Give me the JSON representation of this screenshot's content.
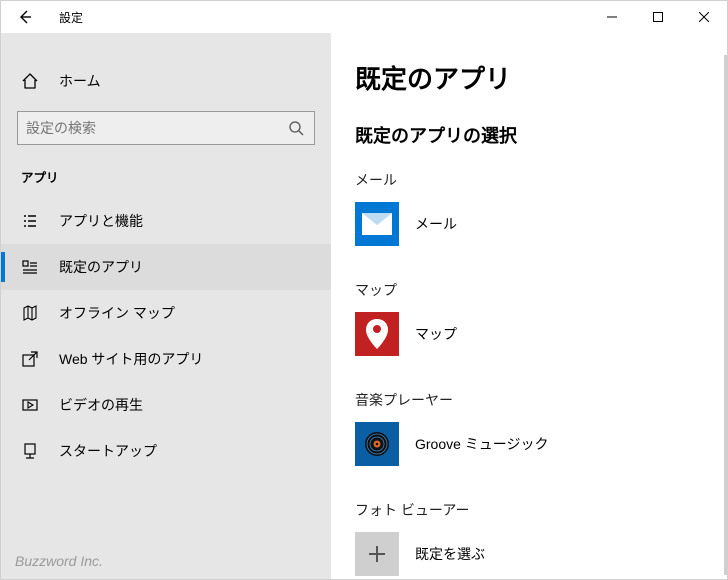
{
  "window": {
    "title": "設定"
  },
  "sidebar": {
    "home": "ホーム",
    "search_placeholder": "設定の検索",
    "section_header": "アプリ",
    "items": [
      {
        "label": "アプリと機能"
      },
      {
        "label": "既定のアプリ"
      },
      {
        "label": "オフライン マップ"
      },
      {
        "label": "Web サイト用のアプリ"
      },
      {
        "label": "ビデオの再生"
      },
      {
        "label": "スタートアップ"
      }
    ]
  },
  "main": {
    "title": "既定のアプリ",
    "subtitle": "既定のアプリの選択",
    "categories": [
      {
        "name": "メール",
        "app": "メール"
      },
      {
        "name": "マップ",
        "app": "マップ"
      },
      {
        "name": "音楽プレーヤー",
        "app": "Groove ミュージック"
      },
      {
        "name": "フォト ビューアー",
        "app": "既定を選ぶ"
      }
    ]
  },
  "watermark": "Buzzword Inc."
}
